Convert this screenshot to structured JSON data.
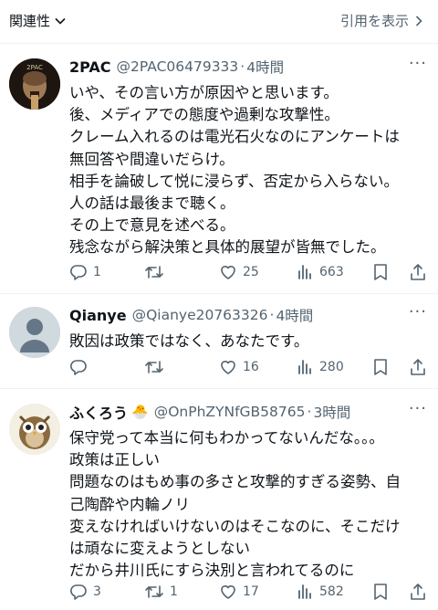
{
  "topbar": {
    "related_label": "関連性",
    "quote_label": "引用を表示"
  },
  "tweets": [
    {
      "name": "2PAC",
      "handle": "@2PAC06479333",
      "time": "4時間",
      "emoji": "",
      "lines": [
        "いや、その言い方が原因やと思います。",
        "後、メディアでの態度や過剰な攻撃性。",
        "クレーム入れるのは電光石火なのにアンケートは",
        "無回答や間違いだらけ。",
        "相手を論破して悦に浸らず、否定から入らない。",
        "人の話は最後まで聴く。",
        "その上で意見を述べる。",
        "残念ながら解決策と具体的展望が皆無でした。"
      ],
      "replies": "1",
      "retweets": "",
      "likes": "25",
      "views": "663"
    },
    {
      "name": "Qianye",
      "handle": "@Qianye20763326",
      "time": "4時間",
      "emoji": "",
      "lines": [
        "敗因は政策ではなく、あなたです。"
      ],
      "replies": "",
      "retweets": "",
      "likes": "16",
      "views": "280"
    },
    {
      "name": "ふくろう",
      "handle": "@OnPhZYNfGB58765",
      "time": "3時間",
      "emoji": "🐣",
      "lines": [
        "保守党って本当に何もわかってないんだな。。。",
        "政策は正しい",
        "問題なのはもめ事の多さと攻撃的すぎる姿勢、自",
        "己陶酔や内輪ノリ",
        "変えなければいけないのはそこなのに、そこだけ",
        "は頑なに変えようとしない",
        "だから井川氏にすら決別と言われてるのに"
      ],
      "replies": "3",
      "retweets": "1",
      "likes": "17",
      "views": "582"
    }
  ],
  "icons": {
    "reply": "reply-icon",
    "retweet": "retweet-icon",
    "like": "heart-icon",
    "views": "views-icon",
    "bookmark": "bookmark-icon",
    "share": "share-icon",
    "more": "more-icon"
  },
  "colors": {
    "text": "#0f1419",
    "secondary": "#536471",
    "divider": "#eff3f4"
  }
}
